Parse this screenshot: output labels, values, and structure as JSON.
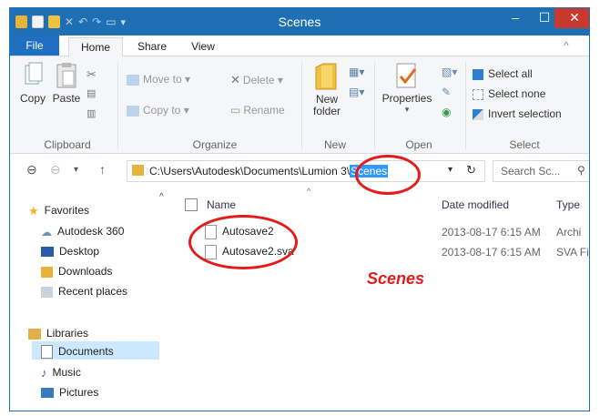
{
  "window": {
    "title": "Scenes"
  },
  "ribbon_tabs": [
    {
      "label": "File"
    },
    {
      "label": "Home"
    },
    {
      "label": "Share"
    },
    {
      "label": "View"
    }
  ],
  "ribbon": {
    "clipboard": {
      "copy": "Copy",
      "paste": "Paste",
      "group_label": "Clipboard"
    },
    "organize": {
      "move_to": "Move to",
      "copy_to": "Copy to",
      "delete": "Delete",
      "rename": "Rename",
      "group_label": "Organize"
    },
    "new": {
      "new_folder_line1": "New",
      "new_folder_line2": "folder",
      "group_label": "New"
    },
    "open": {
      "properties": "Properties",
      "group_label": "Open"
    },
    "select": {
      "select_all": "Select all",
      "select_none": "Select none",
      "invert_selection": "Invert selection",
      "group_label": "Select"
    }
  },
  "address": {
    "path_prefix": "C:\\Users\\Autodesk\\Documents\\Lumion 3\\",
    "path_selected": "Scenes",
    "search_placeholder": "Search Sc..."
  },
  "nav_pane": {
    "favorites": "Favorites",
    "items": [
      "Autodesk 360",
      "Desktop",
      "Downloads",
      "Recent places"
    ],
    "libraries": "Libraries",
    "library_items": [
      "Documents",
      "Music",
      "Pictures"
    ]
  },
  "columns": {
    "name": "Name",
    "date_modified": "Date modified",
    "type": "Type"
  },
  "files": [
    {
      "name": "Autosave2",
      "date": "2013-08-17 6:15 AM",
      "type": "Archi"
    },
    {
      "name": "Autosave2.sva",
      "date": "2013-08-17 6:15 AM",
      "type": "SVA File"
    }
  ],
  "annotation": {
    "label": "Scenes",
    "color": "#e31b1b"
  },
  "colors": {
    "titlebar": "#1f6fb5",
    "file_tab": "#1e6fc2",
    "close": "#c7382d",
    "selection": "#3399ff"
  }
}
